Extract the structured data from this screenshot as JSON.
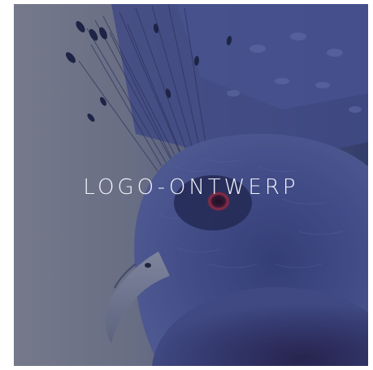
{
  "tile": {
    "title": "LOGO-ONTWERP",
    "image_subject": "victoria-crowned-pigeon-photo",
    "colors": {
      "tint": "#3f4a8a",
      "background_gray": "#8a8f9c",
      "eye": "#b0304a",
      "title_text": "#f2f4fa"
    }
  }
}
